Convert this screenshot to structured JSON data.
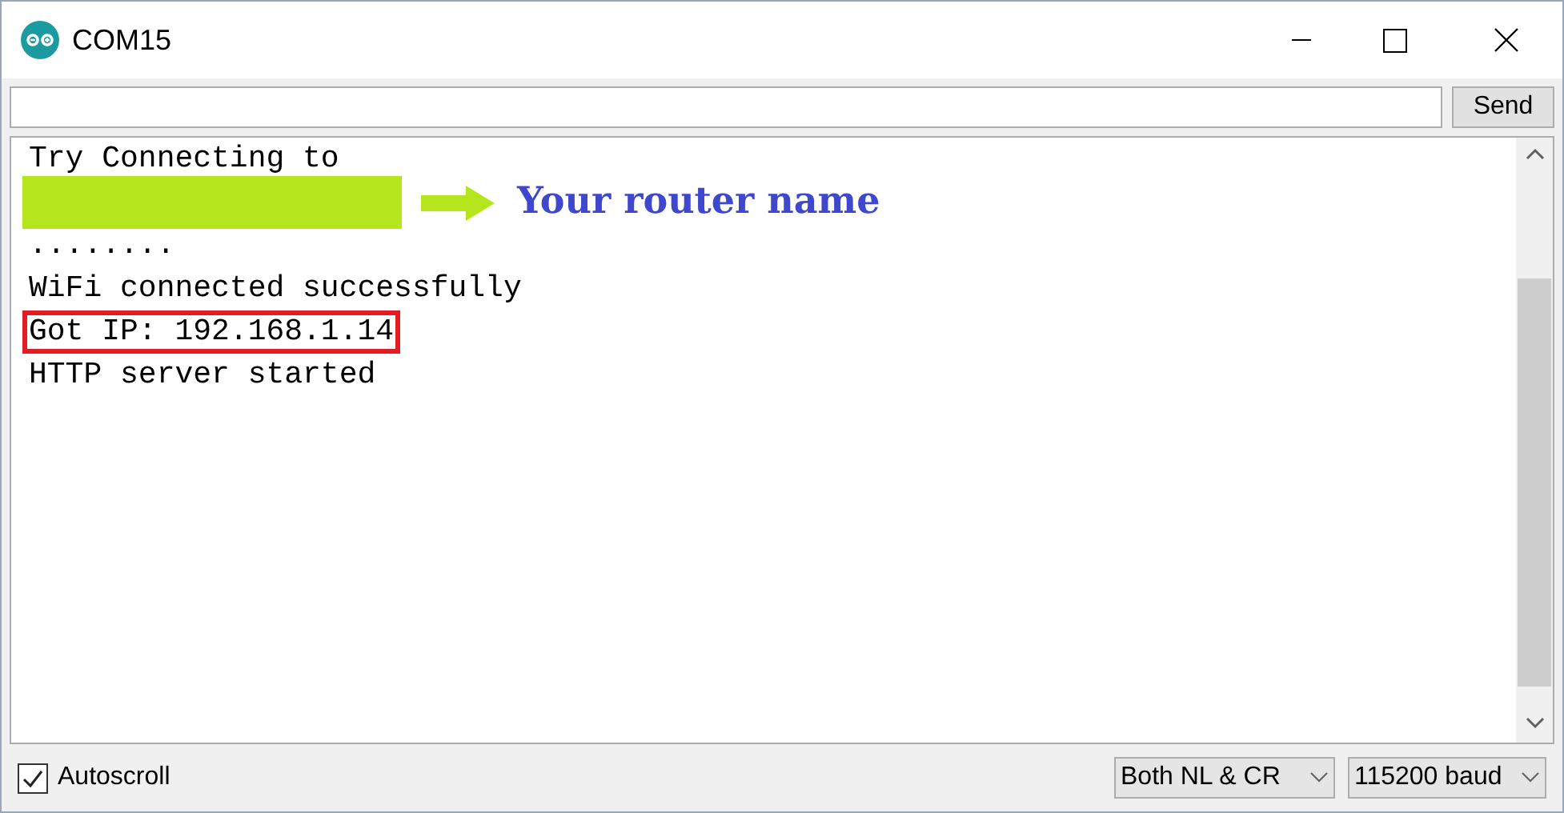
{
  "window": {
    "title": "COM15"
  },
  "send_button": "Send",
  "output": [
    {
      "kind": "text",
      "text": "Try Connecting to"
    },
    {
      "kind": "redacted",
      "annotation": "Your router name"
    },
    {
      "kind": "text",
      "text": "........"
    },
    {
      "kind": "text",
      "text": "WiFi connected successfully"
    },
    {
      "kind": "boxed",
      "text": "Got IP: 192.168.1.14"
    },
    {
      "kind": "text",
      "text": "HTTP server started"
    }
  ],
  "autoscroll": {
    "label": "Autoscroll",
    "checked": true
  },
  "line_ending": "Both NL & CR",
  "baud_rate": "115200 baud"
}
